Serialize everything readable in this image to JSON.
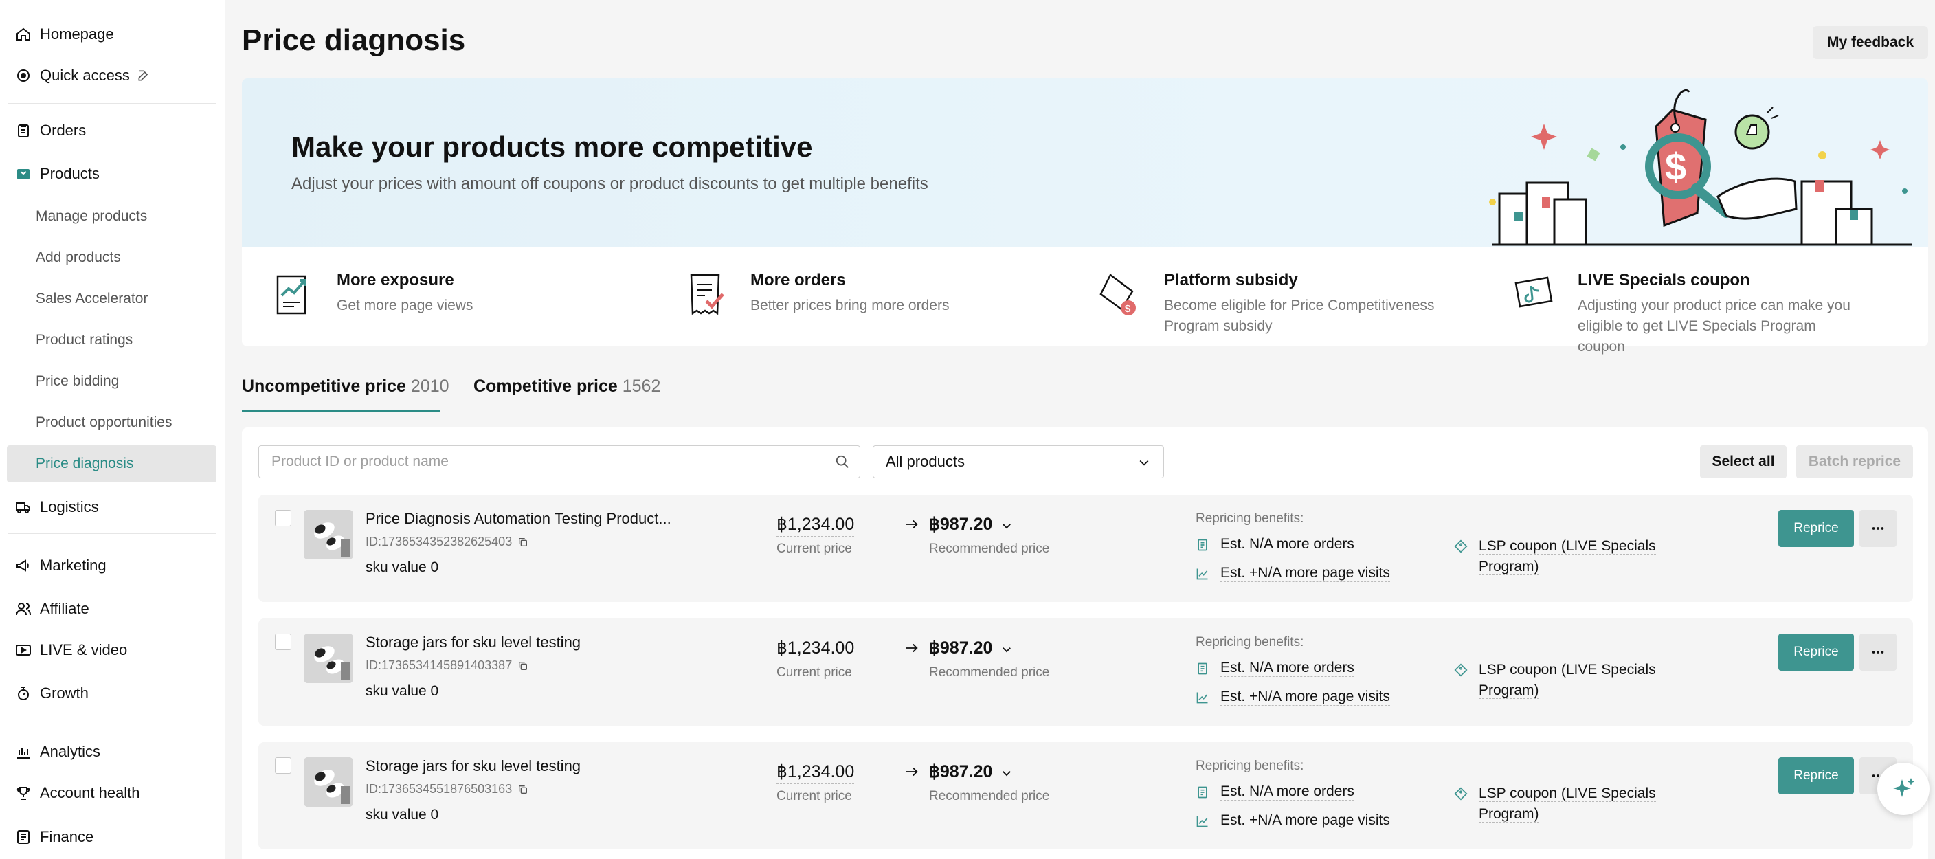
{
  "sidebar": {
    "items": [
      {
        "label": "Homepage",
        "icon": "home-icon"
      },
      {
        "label": "Quick access",
        "icon": "quick-access-icon"
      },
      {
        "label": "Orders",
        "icon": "orders-icon"
      },
      {
        "label": "Products",
        "icon": "products-icon"
      },
      {
        "label": "Logistics",
        "icon": "truck-icon"
      },
      {
        "label": "Marketing",
        "icon": "megaphone-icon"
      },
      {
        "label": "Affiliate",
        "icon": "affiliate-icon"
      },
      {
        "label": "LIVE & video",
        "icon": "live-video-icon"
      },
      {
        "label": "Growth",
        "icon": "growth-icon"
      },
      {
        "label": "Analytics",
        "icon": "analytics-icon"
      },
      {
        "label": "Account health",
        "icon": "trophy-icon"
      },
      {
        "label": "Finance",
        "icon": "finance-icon"
      }
    ],
    "products_sub": [
      "Manage products",
      "Add products",
      "Sales Accelerator",
      "Product ratings",
      "Price bidding",
      "Product opportunities",
      "Price diagnosis"
    ],
    "active_sub": "Price diagnosis"
  },
  "header": {
    "title": "Price diagnosis",
    "feedback_label": "My feedback"
  },
  "banner": {
    "title": "Make your products more competitive",
    "subtitle": "Adjust your prices with amount off coupons or product discounts to get multiple benefits"
  },
  "benefits": [
    {
      "title": "More exposure",
      "desc": "Get more page views",
      "icon": "chart-document-icon"
    },
    {
      "title": "More orders",
      "desc": "Better prices bring more orders",
      "icon": "receipt-check-icon"
    },
    {
      "title": "Platform subsidy",
      "desc": "Become eligible for Price Competitiveness Program subsidy",
      "icon": "subsidy-coupon-icon"
    },
    {
      "title": "LIVE Specials coupon",
      "desc": "Adjusting your product price can make you eligible to get LIVE Specials Program coupon",
      "icon": "live-coupon-icon"
    }
  ],
  "tabs": [
    {
      "label": "Uncompetitive price",
      "count": "2010",
      "active": true
    },
    {
      "label": "Competitive price",
      "count": "1562",
      "active": false
    }
  ],
  "filters": {
    "search_placeholder": "Product ID or product name",
    "select_value": "All products",
    "select_all_label": "Select all",
    "batch_reprice_label": "Batch reprice"
  },
  "colors": {
    "accent": "#2b8c86",
    "button": "#3e9590"
  },
  "products": [
    {
      "name": "Price Diagnosis Automation Testing Product...",
      "id": "ID:1736534352382625403",
      "sku": "sku value 0",
      "current_price": "฿1,234.00",
      "current_label": "Current price",
      "recommended_price": "฿987.20",
      "recommended_label": "Recommended price",
      "benefits_label": "Repricing benefits:",
      "benefit_orders": "Est. N/A more orders",
      "benefit_visits": "Est. +N/A more page visits",
      "lsp_line1": "LSP coupon (LIVE Specials",
      "lsp_line2": "Program)",
      "reprice_label": "Reprice"
    },
    {
      "name": "Storage jars for sku level testing",
      "id": "ID:1736534145891403387",
      "sku": "sku value 0",
      "current_price": "฿1,234.00",
      "current_label": "Current price",
      "recommended_price": "฿987.20",
      "recommended_label": "Recommended price",
      "benefits_label": "Repricing benefits:",
      "benefit_orders": "Est. N/A more orders",
      "benefit_visits": "Est. +N/A more page visits",
      "lsp_line1": "LSP coupon (LIVE Specials",
      "lsp_line2": "Program)",
      "reprice_label": "Reprice"
    },
    {
      "name": "Storage jars for sku level testing",
      "id": "ID:1736534551876503163",
      "sku": "sku value 0",
      "current_price": "฿1,234.00",
      "current_label": "Current price",
      "recommended_price": "฿987.20",
      "recommended_label": "Recommended price",
      "benefits_label": "Repricing benefits:",
      "benefit_orders": "Est. N/A more orders",
      "benefit_visits": "Est. +N/A more page visits",
      "lsp_line1": "LSP coupon (LIVE Specials",
      "lsp_line2": "Program)",
      "reprice_label": "Reprice"
    }
  ]
}
